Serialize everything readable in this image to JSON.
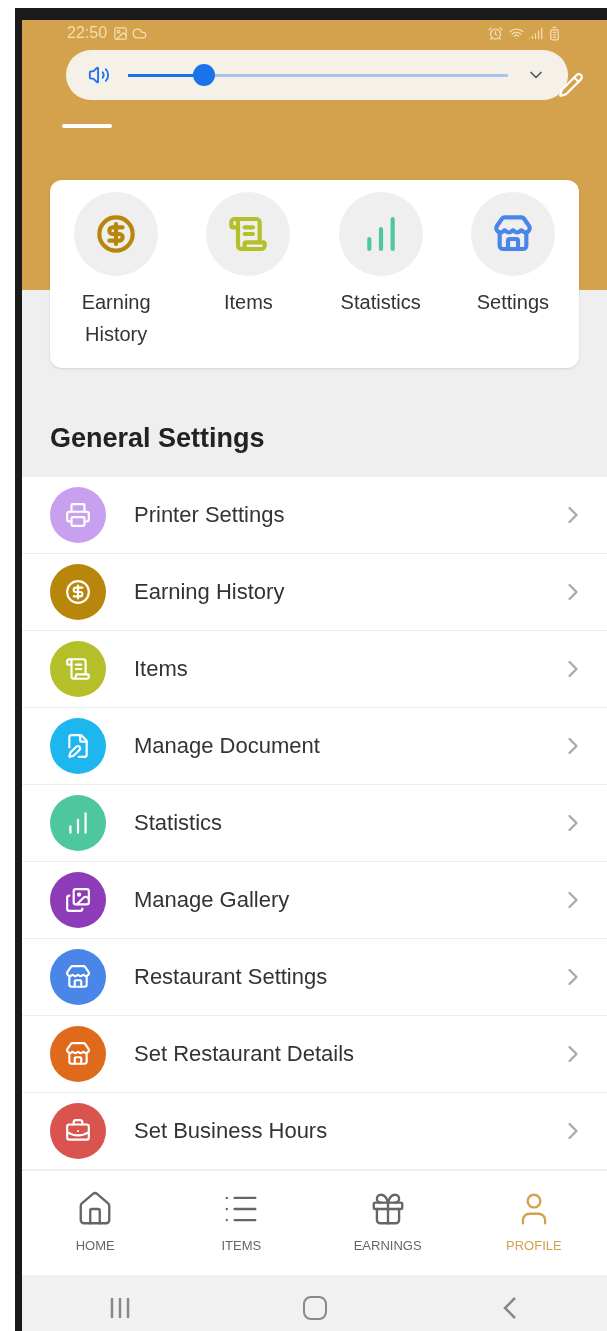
{
  "status_bar": {
    "time": "22:50"
  },
  "volume": {
    "level": 0.2
  },
  "quick_actions": [
    {
      "label": "Earning History",
      "color": "#b8860b"
    },
    {
      "label": "Items",
      "color": "#b5bf2a"
    },
    {
      "label": "Statistics",
      "color": "#4fc79e"
    },
    {
      "label": "Settings",
      "color": "#4a86e8"
    }
  ],
  "section_title": "General Settings",
  "settings": [
    {
      "label": "Printer Settings",
      "color": "#c9a0f0"
    },
    {
      "label": "Earning History",
      "color": "#b8860b"
    },
    {
      "label": "Items",
      "color": "#b5bf2a"
    },
    {
      "label": "Manage Document",
      "color": "#1eb6ee"
    },
    {
      "label": "Statistics",
      "color": "#4fc79e"
    },
    {
      "label": "Manage Gallery",
      "color": "#8e3bb8"
    },
    {
      "label": "Restaurant Settings",
      "color": "#4a86e8"
    },
    {
      "label": "Set Restaurant Details",
      "color": "#e06a1b"
    },
    {
      "label": "Set Business Hours",
      "color": "#d9534f"
    }
  ],
  "bottom_nav": [
    {
      "label": "HOME",
      "selected": false
    },
    {
      "label": "ITEMS",
      "selected": false
    },
    {
      "label": "EARNINGS",
      "selected": false
    },
    {
      "label": "PROFILE",
      "selected": true
    }
  ]
}
